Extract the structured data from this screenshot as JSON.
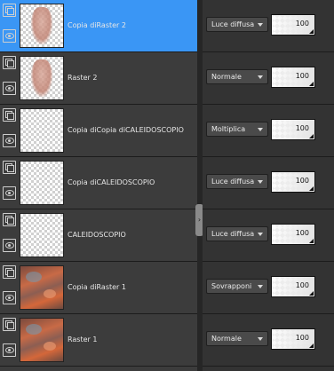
{
  "layers": [
    {
      "name": "Copia diRaster 2",
      "thumb": "face",
      "selected": true,
      "blend": "Luce diffusa",
      "opacity": 100
    },
    {
      "name": "Raster 2",
      "thumb": "face",
      "selected": false,
      "blend": "Normale",
      "opacity": 100
    },
    {
      "name": "Copia diCopia diCALEIDOSCOPIO",
      "thumb": "transparent",
      "selected": false,
      "blend": "Moltiplica",
      "opacity": 100
    },
    {
      "name": "Copia diCALEIDOSCOPIO",
      "thumb": "transparent",
      "selected": false,
      "blend": "Luce diffusa",
      "opacity": 100
    },
    {
      "name": "CALEIDOSCOPIO",
      "thumb": "transparent",
      "selected": false,
      "blend": "Luce diffusa",
      "opacity": 100
    },
    {
      "name": "Copia diRaster 1",
      "thumb": "photo",
      "selected": false,
      "blend": "Sovrapponi",
      "opacity": 100
    },
    {
      "name": "Raster 1",
      "thumb": "photo",
      "selected": false,
      "blend": "Normale",
      "opacity": 100
    }
  ],
  "icons": {
    "group": "layer-group-icon",
    "visibility": "eye-icon",
    "dropdown": "chevron-down-icon",
    "splitter": "panel-collapse-icon"
  },
  "colors": {
    "selected": "#3a96f5",
    "row": "#3c3c3c",
    "props": "#333333"
  }
}
